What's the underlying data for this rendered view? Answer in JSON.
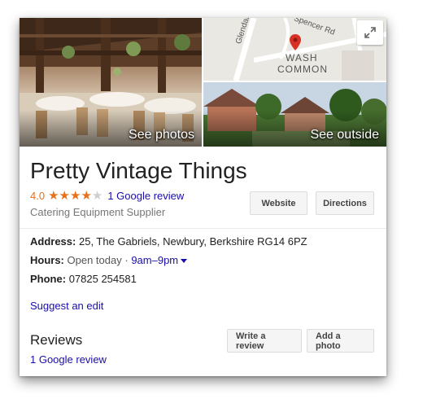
{
  "hero": {
    "photos_label": "See photos",
    "outside_label": "See outside",
    "map": {
      "road_1": "Glendale Av",
      "road_2": "Spencer Rd",
      "area_line_1": "WASH",
      "area_line_2": "COMMON"
    }
  },
  "business": {
    "name": "Pretty Vintage Things",
    "rating": "4.0",
    "stars_filled": 4,
    "stars_total": 5,
    "review_link": "1 Google review",
    "category": "Catering Equipment Supplier"
  },
  "actions": {
    "website": "Website",
    "directions": "Directions",
    "write_review": "Write a review",
    "add_photo": "Add a photo"
  },
  "details": {
    "address_label": "Address:",
    "address_value": "25, The Gabriels, Newbury, Berkshire RG14 6PZ",
    "hours_label": "Hours:",
    "hours_status": "Open today",
    "hours_sep": "·",
    "hours_value": "9am–9pm",
    "phone_label": "Phone:",
    "phone_value": "07825 254581"
  },
  "suggest_edit": "Suggest an edit",
  "reviews": {
    "heading": "Reviews",
    "count_link": "1 Google review"
  },
  "colors": {
    "accent_link": "#1a0dab",
    "star": "#e7711b",
    "map_pin": "#d93025"
  }
}
